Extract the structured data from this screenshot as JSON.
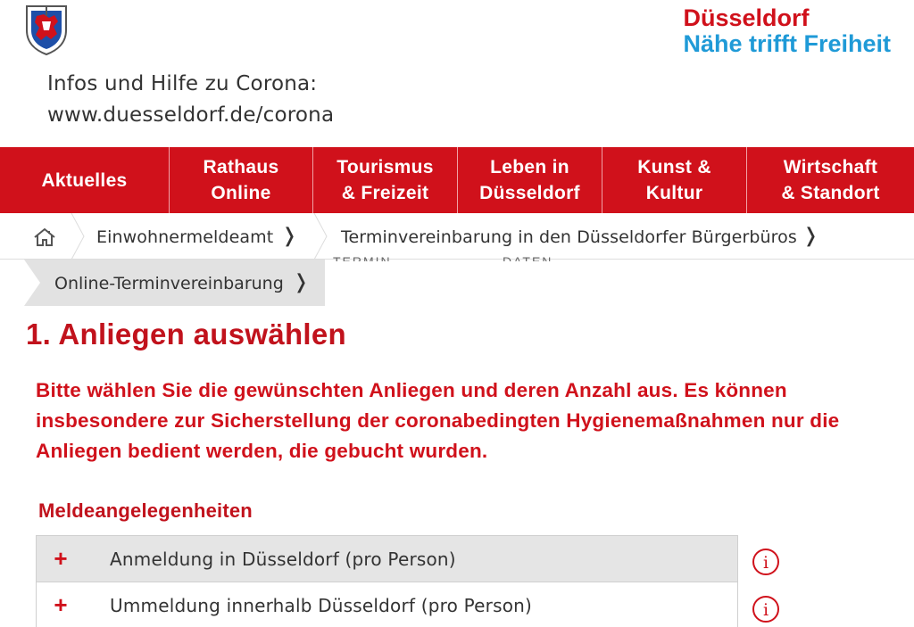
{
  "header": {
    "brand_line1": "Düsseldorf",
    "brand_line2": "Nähe trifft Freiheit",
    "corona_line1": "Infos und Hilfe zu Corona:",
    "corona_line2": "www.duesseldorf.de/corona",
    "logo_icon": "coat-of-arms-icon"
  },
  "nav": {
    "items": [
      {
        "line1": "Aktuelles",
        "line2": ""
      },
      {
        "line1": "Rathaus",
        "line2": "Online"
      },
      {
        "line1": "Tourismus",
        "line2": "& Freizeit"
      },
      {
        "line1": "Leben in",
        "line2": "Düsseldorf"
      },
      {
        "line1": "Kunst &",
        "line2": "Kultur"
      },
      {
        "line1": "Wirtschaft",
        "line2": "& Standort"
      }
    ]
  },
  "breadcrumb": {
    "home_icon": "home-icon",
    "items": [
      "Einwohnermeldeamt",
      "Terminvereinbarung in den Düsseldorfer Bürgerbüros",
      "Online-Terminvereinbarung"
    ],
    "chevron": "❭",
    "ghost_text_1": "TERMIN",
    "ghost_text_2": "DATEN"
  },
  "main": {
    "title": "1. Anliegen auswählen",
    "intro": "Bitte wählen Sie die gewünschten Anliegen und deren Anzahl aus. Es können insbesondere zur Sicherstellung der coronabedingten Hygienemaßnahmen nur die Anliegen bedient werden, die gebucht wurden.",
    "section_title": "Meldeangelegenheiten",
    "rows": [
      {
        "label": "Anmeldung in Düsseldorf (pro Person)",
        "add": "+",
        "info": "i"
      },
      {
        "label": "Ummeldung innerhalb Düsseldorf (pro Person)",
        "add": "+",
        "info": "i"
      }
    ]
  },
  "colors": {
    "accent_red": "#d0111b",
    "brand_blue": "#1f9ad7",
    "active_crumb_bg": "#e2e2e2"
  }
}
